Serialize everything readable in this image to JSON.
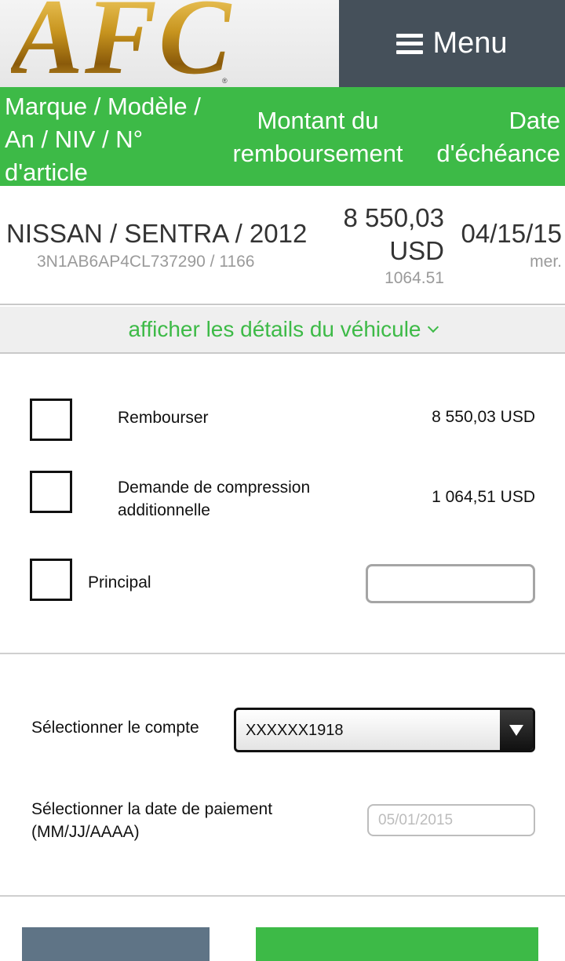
{
  "header": {
    "logo_text": "AFC",
    "logo_reg": "®",
    "menu_label": "Menu"
  },
  "table_header": {
    "col1": "Marque / Modèle / An / NIV / N° d'article",
    "col2": "Montant du remboursement",
    "col3": "Date d'échéance"
  },
  "vehicle": {
    "title": "NISSAN / SENTRA / 2012",
    "vin_item": "3N1AB6AP4CL737290 / 1166",
    "amount": "8 550,03 USD",
    "amount_sub": "1064.51",
    "due_date": "04/15/15",
    "due_day": "mer."
  },
  "details_link": "afficher les détails du véhicule",
  "options": {
    "rembourser_label": "Rembourser",
    "rembourser_value": "8 550,03 USD",
    "compression_label": "Demande de compression additionnelle",
    "compression_value": "1 064,51 USD",
    "principal_label": "Principal",
    "principal_value": ""
  },
  "account": {
    "label": "Sélectionner le compte",
    "selected": "XXXXXX1918"
  },
  "payment_date": {
    "label": "Sélectionner la date de paiement (MM/JJ/AAAA)",
    "placeholder": "05/01/2015"
  },
  "colors": {
    "brand_green": "#3dba47",
    "menu_gray": "#45505a",
    "secondary_button": "#5f7486"
  }
}
